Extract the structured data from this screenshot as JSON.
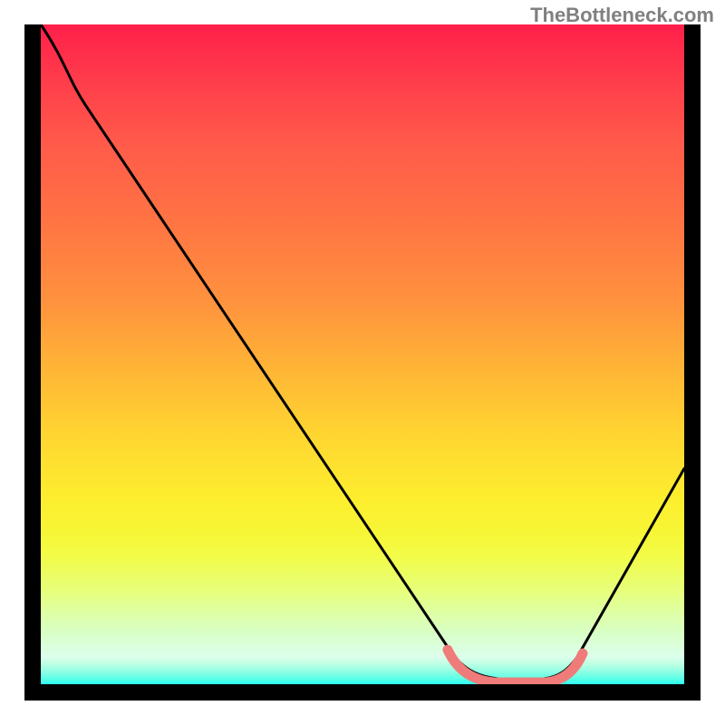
{
  "attribution": "TheBottleneck.com",
  "chart_data": {
    "type": "line",
    "title": "",
    "xlabel": "",
    "ylabel": "",
    "xlim": [
      0,
      100
    ],
    "ylim": [
      0,
      100
    ],
    "categories_x_pct": [
      0,
      5,
      10,
      15,
      20,
      25,
      30,
      35,
      40,
      45,
      50,
      55,
      60,
      65,
      70,
      75,
      80,
      85,
      90,
      95,
      100
    ],
    "values_y_pct": [
      100,
      93,
      85,
      78,
      71,
      64,
      56,
      49,
      42,
      35,
      28,
      20,
      13,
      6,
      2,
      0,
      0,
      4,
      12,
      22,
      34
    ],
    "highlighted_segment_x_pct": [
      65,
      80
    ],
    "gradient_colors": [
      "#ff1f4a",
      "#ffb436",
      "#fdee2e",
      "#2bffef"
    ],
    "description": "V-shaped bottleneck curve over a vertical red-to-cyan gradient. Minimum (optimal) region around x=65%–80%. A salmon-colored bracket highlights that optimum range."
  },
  "colors": {
    "curve": "#000000",
    "highlight": "#ef7c7a",
    "frame": "#000000"
  }
}
